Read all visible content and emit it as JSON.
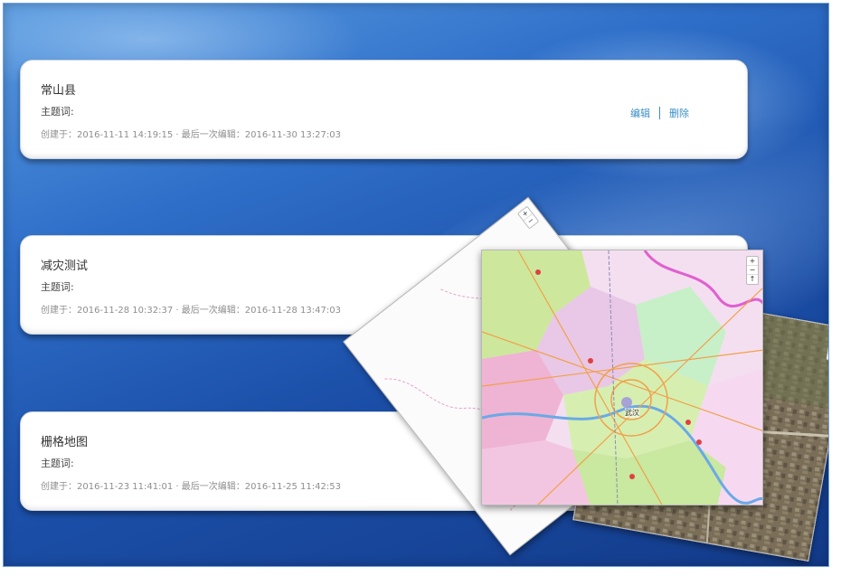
{
  "projects": [
    {
      "title": "常山县",
      "keyword_label": "主题词:",
      "meta": "创建于：2016-11-11 14:19:15 · 最后一次编辑：2016-11-30 13:27:03",
      "edit_label": "编辑",
      "delete_label": "删除"
    },
    {
      "title": "减灾测试",
      "keyword_label": "主题词:",
      "meta": "创建于：2016-11-28 10:32:37 · 最后一次编辑：2016-11-28 13:47:03"
    },
    {
      "title": "栅格地图",
      "keyword_label": "主题词:",
      "meta": "创建于：2016-11-23 11:41:01 · 最后一次编辑：2016-11-25 11:42:53"
    }
  ],
  "map_preview": {
    "zoom_in": "+",
    "zoom_out": "−",
    "reset": "↑",
    "city_label": "武汉",
    "colors": {
      "accent_link": "#3b8fc4",
      "desktop_blue": "#1b4fa8"
    }
  }
}
